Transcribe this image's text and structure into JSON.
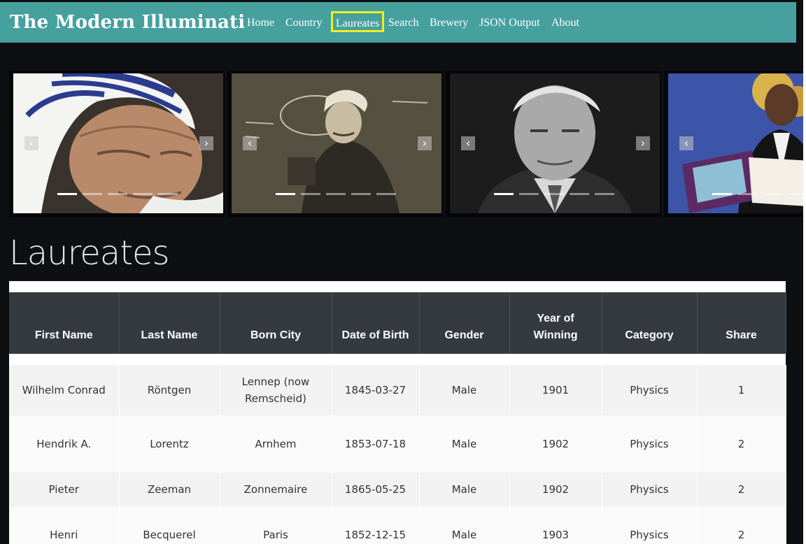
{
  "app": {
    "brand": "The Modern Illuminati"
  },
  "nav": {
    "items": [
      "Home",
      "Country",
      "Laureates",
      "Search",
      "Brewery",
      "JSON Output",
      "About"
    ],
    "active": "Laureates"
  },
  "carousel": {
    "slides": [
      {
        "subject": "portrait-headscarf",
        "active_indicator": 0
      },
      {
        "subject": "portrait-chalkboard",
        "active_indicator": 0
      },
      {
        "subject": "portrait-grey-hair",
        "active_indicator": 0
      },
      {
        "subject": "portrait-medal-diploma",
        "active_indicator": 0
      }
    ],
    "indicator_count": 5,
    "prev_icon": "chevron-left-icon",
    "next_icon": "chevron-right-icon"
  },
  "page": {
    "title": "Laureates"
  },
  "table": {
    "headers": [
      "First Name",
      "Last Name",
      "Born City",
      "Date of Birth",
      "Gender",
      "Year of Winning",
      "Category",
      "Share"
    ],
    "rows": [
      [
        "Wilhelm Conrad",
        "Röntgen",
        "Lennep (now Remscheid)",
        "1845-03-27",
        "Male",
        "1901",
        "Physics",
        "1"
      ],
      [
        "Hendrik A.",
        "Lorentz",
        "Arnhem",
        "1853-07-18",
        "Male",
        "1902",
        "Physics",
        "2"
      ],
      [
        "Pieter",
        "Zeeman",
        "Zonnemaire",
        "1865-05-25",
        "Male",
        "1902",
        "Physics",
        "2"
      ],
      [
        "Henri",
        "Becquerel",
        "Paris",
        "1852-12-15",
        "Male",
        "1903",
        "Physics",
        "2"
      ]
    ]
  },
  "colors": {
    "navbar": "#46a09e",
    "highlight": "#f2ee1d",
    "background": "#0e0f12",
    "table_header": "#343a40"
  }
}
